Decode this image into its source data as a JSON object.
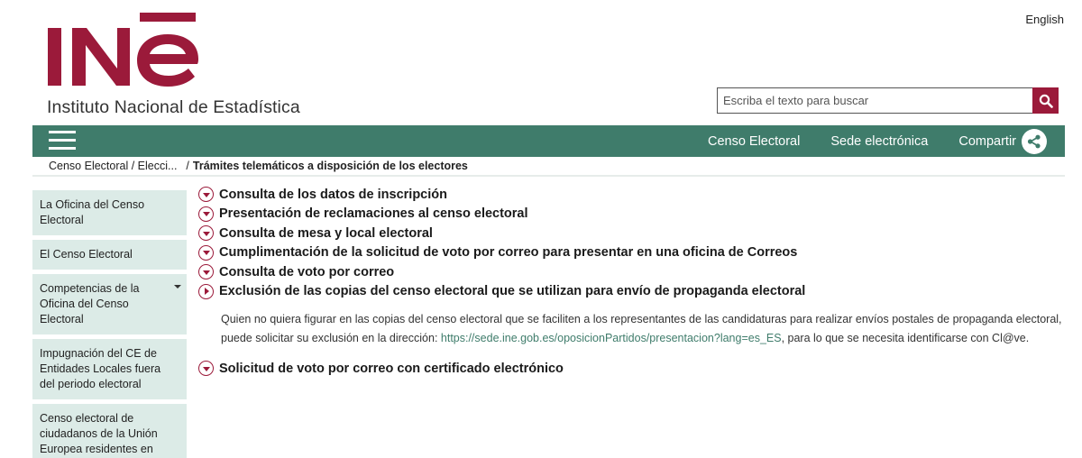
{
  "header": {
    "logo_text": "INĒ",
    "logo_subtitle": "Instituto Nacional de Estadística",
    "language_link": "English"
  },
  "search": {
    "placeholder": "Escriba el texto para buscar"
  },
  "nav": {
    "items": [
      {
        "label": "Censo Electoral"
      },
      {
        "label": "Sede electrónica"
      },
      {
        "label": "Compartir"
      }
    ]
  },
  "breadcrumb": {
    "parent": "Censo Electoral / Elecci...",
    "separator": "/",
    "current": "Trámites telemáticos a disposición de los electores"
  },
  "sidebar": {
    "items": [
      {
        "label": "La Oficina del Censo Electoral"
      },
      {
        "label": "El Censo Electoral"
      },
      {
        "label": "Competencias de la Oficina del Censo Electoral"
      },
      {
        "label": "Impugnación del CE de Entidades Locales fuera del periodo electoral"
      },
      {
        "label": "Censo electoral de ciudadanos de la Unión Europea residentes en"
      }
    ]
  },
  "accordion": {
    "items": [
      {
        "title": "Consulta de los datos de inscripción"
      },
      {
        "title": "Presentación de reclamaciones al censo electoral"
      },
      {
        "title": "Consulta de mesa y local electoral"
      },
      {
        "title": "Cumplimentación de la solicitud de voto por correo para presentar en una oficina de Correos"
      },
      {
        "title": "Consulta de voto por correo"
      },
      {
        "title": "Exclusión de las copias del censo electoral que se utilizan para envío de propaganda electoral"
      },
      {
        "title": "Solicitud de voto por correo con certificado electrónico"
      }
    ],
    "expanded_body": {
      "before_link": "Quien no quiera figurar en las copias del censo electoral que se faciliten a los representantes de las candidaturas para realizar envíos postales de propaganda electoral, puede solicitar su exclusión en la dirección: ",
      "link": "https://sede.ine.gob.es/oposicionPartidos/presentacion?lang=es_ES",
      "after_link": ", para lo que se necesita identificarse con Cl@ve."
    }
  },
  "colors": {
    "brand_red": "#9b1a3a",
    "nav_green": "#3f7c6b",
    "sidebar_bg": "#dcebe7"
  }
}
